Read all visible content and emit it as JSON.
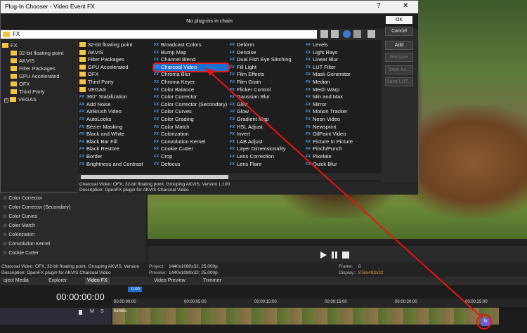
{
  "dialog": {
    "title": "Plug-In Chooser - Video Event FX",
    "help_label": "?",
    "close_label": "✕",
    "chain_text": "No plug-ins in chain",
    "path": "FX",
    "buttons": {
      "ok": "OK",
      "cancel": "Cancel",
      "add": "Add",
      "remove": "Remove",
      "save_as": "Save As...",
      "save_lut": "Save LUT..."
    },
    "tree": {
      "root": "FX",
      "items": [
        "32-bit floating point",
        "AKVIS",
        "Filter Packages",
        "GPU Accelerated",
        "OFX",
        "Third Party",
        "VEGAS"
      ]
    },
    "grid": {
      "col1": [
        "32-bit floating point",
        "AKVIS",
        "Filter Packages",
        "GPU Accelerated",
        "OFX",
        "Third Party",
        "VEGAS",
        "360° Stabilization",
        "Add Noise",
        "AirBrush Video",
        "AutoLooks",
        "Bézier Masking",
        "Black and White",
        "Black Bar Fill",
        "Black Restore",
        "Border",
        "Brightness and Contrast"
      ],
      "col2": [
        "Broadcast Colors",
        "Bump Map",
        "Channel Blend",
        "Charcoal Video",
        "Chroma Blur",
        "Chroma Keyer",
        "Color Balance",
        "Color Corrector",
        "Color Corrector (Secondary)",
        "Color Curves",
        "Color Grading",
        "Color Match",
        "Colorization",
        "Convolution Kernel",
        "Cookie Cutter",
        "Crop",
        "Defocus"
      ],
      "col3": [
        "Deform",
        "Denoise",
        "Dual Fish Eye Stitching",
        "Fill Light",
        "Film Effects",
        "Film Grain",
        "Flicker Control",
        "Gaussian Blur",
        "Glint",
        "Glow",
        "Gradient Map",
        "HSL Adjust",
        "Invert",
        "LAB Adjust",
        "Layer Dimensionality",
        "Lens Correction",
        "Lens Flare"
      ],
      "col4": [
        "Levels",
        "Light Rays",
        "Linear Blur",
        "LUT Filter",
        "Mask Generator",
        "Median",
        "Mesh Warp",
        "Min and Max",
        "Mirror",
        "Motion Tracker",
        "Neon Video",
        "Newsprint",
        "OilPaint Video",
        "Picture In Picture",
        "Pinch/Punch",
        "Pixelate",
        "Quick Blur"
      ],
      "selected": "Charcoal Video",
      "fx_tag": "FX"
    },
    "description": {
      "line1": "Charcoal Video: OFX, 32-bit floating point, Grouping AKVIS, Version 1.100",
      "line2": "Description: OpenFX plugin for AKVIS Charcoal Video"
    }
  },
  "background": {
    "side_list": [
      "Color Corrector",
      "Color Corrector (Secondary)",
      "Color Curves",
      "Color Match",
      "Colorization",
      "Convolution Kernel",
      "Cookie Cutter"
    ],
    "info_left1": "Charcoal Video: OFX, 32-bit floating point, Grouping AKVIS, Version",
    "info_left2": "Description: OpenFX plugin for AKVIS Charcoal Video",
    "project_label": "Project:",
    "project_value": "1440x1080x32; 25,000p",
    "preview_label": "Preview:",
    "preview_value": "1440x1080x32; 25,000p",
    "frame_label": "Frame:",
    "frame_value": "0",
    "display_label": "Display:",
    "display_value": "876x493x32",
    "tabs": [
      "oject Media",
      "Explorer",
      "Video FX",
      "Video Preview",
      "Trimmer"
    ],
    "timecode": "00:00:00:00",
    "ruler": [
      "00:00:00:00",
      "00:00:05:00",
      "00:00:10:00",
      "00:00:15:00",
      "00:00:20:00",
      "00:00:25:00"
    ],
    "rate": "-0.00",
    "clip_name": "horses",
    "track_buttons": [
      "M",
      "S"
    ],
    "fx_badge": "fx"
  },
  "colors": {
    "accent": "#1e6fd0",
    "highlight": "#e41e1e",
    "folder": "#f6c343",
    "fx": "#4aa3ff"
  }
}
